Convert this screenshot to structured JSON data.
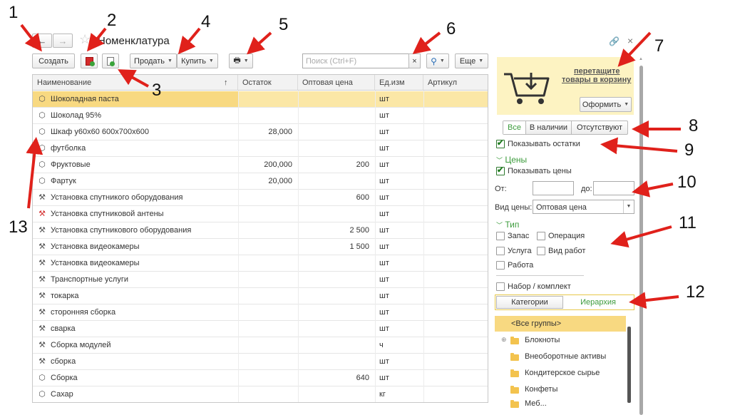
{
  "window": {
    "title": "Номенклатура"
  },
  "toolbar": {
    "create_label": "Создать",
    "sell_label": "Продать",
    "buy_label": "Купить",
    "more_label": "Еще",
    "search_placeholder": "Поиск (Ctrl+F)",
    "search_clear": "×"
  },
  "table": {
    "columns": [
      "Наименование",
      "Остаток",
      "Оптовая цена",
      "Ед.изм",
      "Артикул"
    ],
    "sort_indicator": "↑",
    "rows": [
      {
        "name": "Шоколадная паста",
        "stock": "",
        "price": "",
        "unit": "шт",
        "sku": "",
        "icon": "box-icon"
      },
      {
        "name": "Шоколад 95%",
        "stock": "",
        "price": "",
        "unit": "шт",
        "sku": "",
        "icon": "box-icon"
      },
      {
        "name": "Шкаф у60х60 600х700х600",
        "stock": "28,000",
        "price": "",
        "unit": "шт",
        "sku": "",
        "icon": "box-icon"
      },
      {
        "name": "футболка",
        "stock": "",
        "price": "",
        "unit": "шт",
        "sku": "",
        "icon": "box-icon"
      },
      {
        "name": "Фруктовые",
        "stock": "200,000",
        "price": "200",
        "unit": "шт",
        "sku": "",
        "icon": "box-icon"
      },
      {
        "name": "Фартук",
        "stock": "20,000",
        "price": "",
        "unit": "шт",
        "sku": "",
        "icon": "box-icon"
      },
      {
        "name": "Установка спутникого оборудования",
        "stock": "",
        "price": "600",
        "unit": "шт",
        "sku": "",
        "icon": "tools-icon"
      },
      {
        "name": "Установка спутниковой антены",
        "stock": "",
        "price": "",
        "unit": "шт",
        "sku": "",
        "icon": "tools-deleted-icon"
      },
      {
        "name": "Установка спутникового оборудования",
        "stock": "",
        "price": "2 500",
        "unit": "шт",
        "sku": "",
        "icon": "tools-icon"
      },
      {
        "name": "Установка видеокамеры",
        "stock": "",
        "price": "1 500",
        "unit": "шт",
        "sku": "",
        "icon": "tools-icon"
      },
      {
        "name": "Установка видеокамеры",
        "stock": "",
        "price": "",
        "unit": "шт",
        "sku": "",
        "icon": "tools-icon"
      },
      {
        "name": "Транспортные услуги",
        "stock": "",
        "price": "",
        "unit": "шт",
        "sku": "",
        "icon": "tools-icon"
      },
      {
        "name": "токарка",
        "stock": "",
        "price": "",
        "unit": "шт",
        "sku": "",
        "icon": "tools-icon"
      },
      {
        "name": "сторонняя сборка",
        "stock": "",
        "price": "",
        "unit": "шт",
        "sku": "",
        "icon": "tools-icon"
      },
      {
        "name": "сварка",
        "stock": "",
        "price": "",
        "unit": "шт",
        "sku": "",
        "icon": "tools-icon"
      },
      {
        "name": "Сборка модулей",
        "stock": "",
        "price": "",
        "unit": "ч",
        "sku": "",
        "icon": "tools-icon"
      },
      {
        "name": "сборка",
        "stock": "",
        "price": "",
        "unit": "шт",
        "sku": "",
        "icon": "tools-icon"
      },
      {
        "name": "Сборка",
        "stock": "",
        "price": "640",
        "unit": "шт",
        "sku": "",
        "icon": "box-icon"
      },
      {
        "name": "Сахар",
        "stock": "",
        "price": "",
        "unit": "кг",
        "sku": "",
        "icon": "box-icon"
      }
    ]
  },
  "cart": {
    "hint_line1": "перетащите",
    "hint_line2": "товары в корзину",
    "checkout_label": "Оформить"
  },
  "filter": {
    "availability_tabs": [
      "Все",
      "В наличии",
      "Отсутствуют"
    ],
    "show_stock_label": "Показывать остатки",
    "prices_section": "Цены",
    "show_prices_label": "Показывать цены",
    "from_label": "От:",
    "to_label": "до:",
    "price_kind_label": "Вид цены:",
    "price_kind_value": "Оптовая цена",
    "type_section": "Тип",
    "types": [
      "Запас",
      "Операция",
      "Услуга",
      "Вид работ",
      "Работа"
    ],
    "kit_label": "Набор / комплект",
    "view_tabs": [
      "Категории",
      "Иерархия"
    ]
  },
  "tree": {
    "items": [
      "<Все группы>",
      "Блокноты",
      "Внеоборотные активы",
      "Кондитерское сырье",
      "Конфеты",
      "Меб..."
    ]
  },
  "annotations": [
    "1",
    "2",
    "3",
    "4",
    "5",
    "6",
    "7",
    "8",
    "9",
    "10",
    "11",
    "12",
    "13"
  ],
  "colors": {
    "selection": "#fbe7a6",
    "cart_bg": "#fdf3c2",
    "accent_green": "#3c9b3c",
    "arrow_red": "#e0211b"
  }
}
